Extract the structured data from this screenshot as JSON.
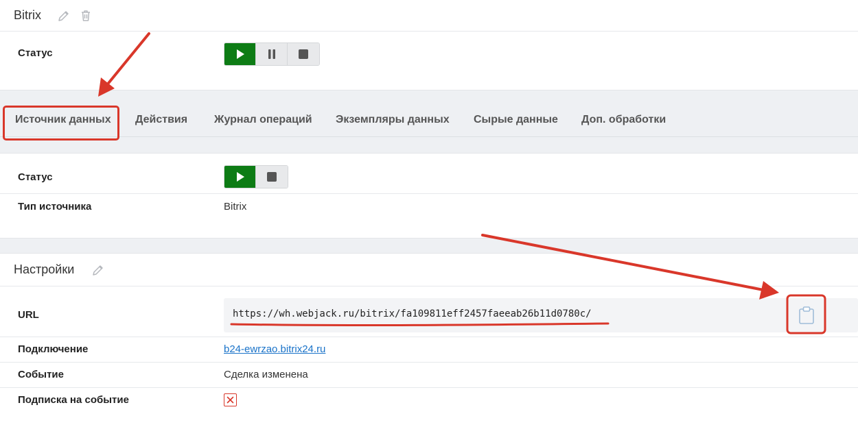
{
  "header": {
    "title": "Bitrix"
  },
  "top": {
    "status_label": "Статус"
  },
  "tabs": [
    {
      "label": "Источник данных"
    },
    {
      "label": "Действия"
    },
    {
      "label": "Журнал операций"
    },
    {
      "label": "Экземпляры данных"
    },
    {
      "label": "Сырые данные"
    },
    {
      "label": "Доп. обработки"
    }
  ],
  "source": {
    "status_label": "Статус",
    "type_label": "Тип источника",
    "type_value": "Bitrix"
  },
  "settings": {
    "title": "Настройки",
    "url_label": "URL",
    "url_value": "https://wh.webjack.ru/bitrix/fa109811eff2457faeeab26b11d0780c/",
    "connection_label": "Подключение",
    "connection_value": "b24-ewrzao.bitrix24.ru",
    "event_label": "Событие",
    "event_value": "Сделка изменена",
    "subscription_label": "Подписка на событие"
  },
  "colors": {
    "accent_green": "#0d7c15",
    "annotation_red": "#d9372a",
    "link_blue": "#1a73c9"
  },
  "icons": [
    "pencil-icon",
    "trash-icon",
    "play-icon",
    "pause-icon",
    "stop-icon",
    "clipboard-icon",
    "x-mark-icon"
  ]
}
